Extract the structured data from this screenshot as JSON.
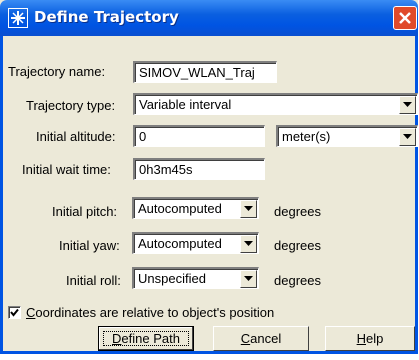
{
  "window": {
    "title": "Define Trajectory",
    "title_icon": "star-icon",
    "close_icon": "close-icon"
  },
  "fields": {
    "trajectory_name": {
      "label": "Trajectory name:",
      "value": "SIMOV_WLAN_Traj"
    },
    "trajectory_type": {
      "label": "Trajectory type:",
      "value": "Variable interval"
    },
    "initial_altitude": {
      "label": "Initial altitude:",
      "value": "0",
      "unit": "meter(s)"
    },
    "initial_wait_time": {
      "label": "Initial wait time:",
      "value": "0h3m45s"
    },
    "initial_pitch": {
      "label": "Initial pitch:",
      "value": "Autocomputed",
      "unit": "degrees"
    },
    "initial_yaw": {
      "label": "Initial yaw:",
      "value": "Autocomputed",
      "unit": "degrees"
    },
    "initial_roll": {
      "label": "Initial roll:",
      "value": "Unspecified",
      "unit": "degrees"
    }
  },
  "checkbox": {
    "label_accel": "C",
    "label_rest": "oordinates are relative to object's position",
    "checked": true
  },
  "buttons": {
    "define_path": {
      "accel": "D",
      "rest": "efine Path"
    },
    "cancel": {
      "accel": "C",
      "rest": "ancel"
    },
    "help": {
      "accel": "H",
      "rest": "elp"
    }
  },
  "colors": {
    "titlebar": "#0054e3",
    "dialog_bg": "#ece9d8",
    "close_button": "#e04a2a"
  }
}
